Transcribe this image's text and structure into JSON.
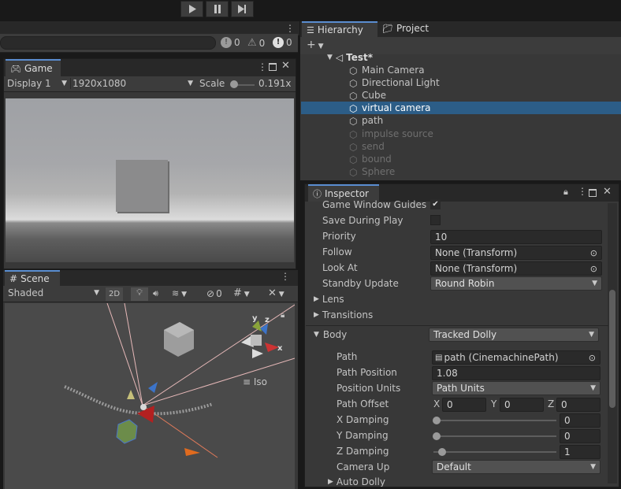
{
  "toolbar": {
    "play_icon": "play-icon",
    "pause_icon": "pause-icon",
    "step_icon": "step-icon"
  },
  "console": {
    "info_count": "0",
    "warn_count": "0",
    "error_count": "0"
  },
  "game": {
    "tab_label": "Game",
    "display": "Display 1",
    "resolution": "1920x1080",
    "scale_label": "Scale",
    "scale_value": "0.191x"
  },
  "scene": {
    "tab_label": "Scene",
    "shading": "Shaded",
    "mode_2d": "2D",
    "hidden_count": "0",
    "iso_label": "Iso",
    "gizmo_x": "x",
    "gizmo_y": "y",
    "gizmo_z": "z"
  },
  "hierarchy": {
    "tab_label": "Hierarchy",
    "project_tab": "Project",
    "scene_name": "Test*",
    "items": [
      {
        "label": "Main Camera",
        "active": true,
        "selected": false
      },
      {
        "label": "Directional Light",
        "active": true,
        "selected": false
      },
      {
        "label": "Cube",
        "active": true,
        "selected": false
      },
      {
        "label": "virtual camera",
        "active": true,
        "selected": true
      },
      {
        "label": "path",
        "active": true,
        "selected": false
      },
      {
        "label": "impulse source",
        "active": false,
        "selected": false
      },
      {
        "label": "send",
        "active": false,
        "selected": false
      },
      {
        "label": "bound",
        "active": false,
        "selected": false
      },
      {
        "label": "Sphere",
        "active": false,
        "selected": false
      }
    ]
  },
  "inspector": {
    "tab_label": "Inspector",
    "game_window_guides": "Game Window Guides",
    "save_during_play": "Save During Play",
    "priority_label": "Priority",
    "priority_value": "10",
    "follow_label": "Follow",
    "follow_value": "None (Transform)",
    "lookat_label": "Look At",
    "lookat_value": "None (Transform)",
    "standby_label": "Standby Update",
    "standby_value": "Round Robin",
    "lens_label": "Lens",
    "transitions_label": "Transitions",
    "body_label": "Body",
    "body_value": "Tracked Dolly",
    "path_label": "Path",
    "path_value": "path (CinemachinePath)",
    "path_position_label": "Path Position",
    "path_position_value": "1.08",
    "position_units_label": "Position Units",
    "position_units_value": "Path Units",
    "path_offset_label": "Path Offset",
    "offset_x_label": "X",
    "offset_x": "0",
    "offset_y_label": "Y",
    "offset_y": "0",
    "offset_z_label": "Z",
    "offset_z": "0",
    "x_damping_label": "X Damping",
    "x_damping": "0",
    "y_damping_label": "Y Damping",
    "y_damping": "0",
    "z_damping_label": "Z Damping",
    "z_damping": "1",
    "camera_up_label": "Camera Up",
    "camera_up_value": "Default",
    "auto_dolly_label": "Auto Dolly"
  },
  "colors": {
    "accent": "#2c5d87",
    "tab_highlight": "#5a8dd0",
    "panel": "#383838"
  }
}
